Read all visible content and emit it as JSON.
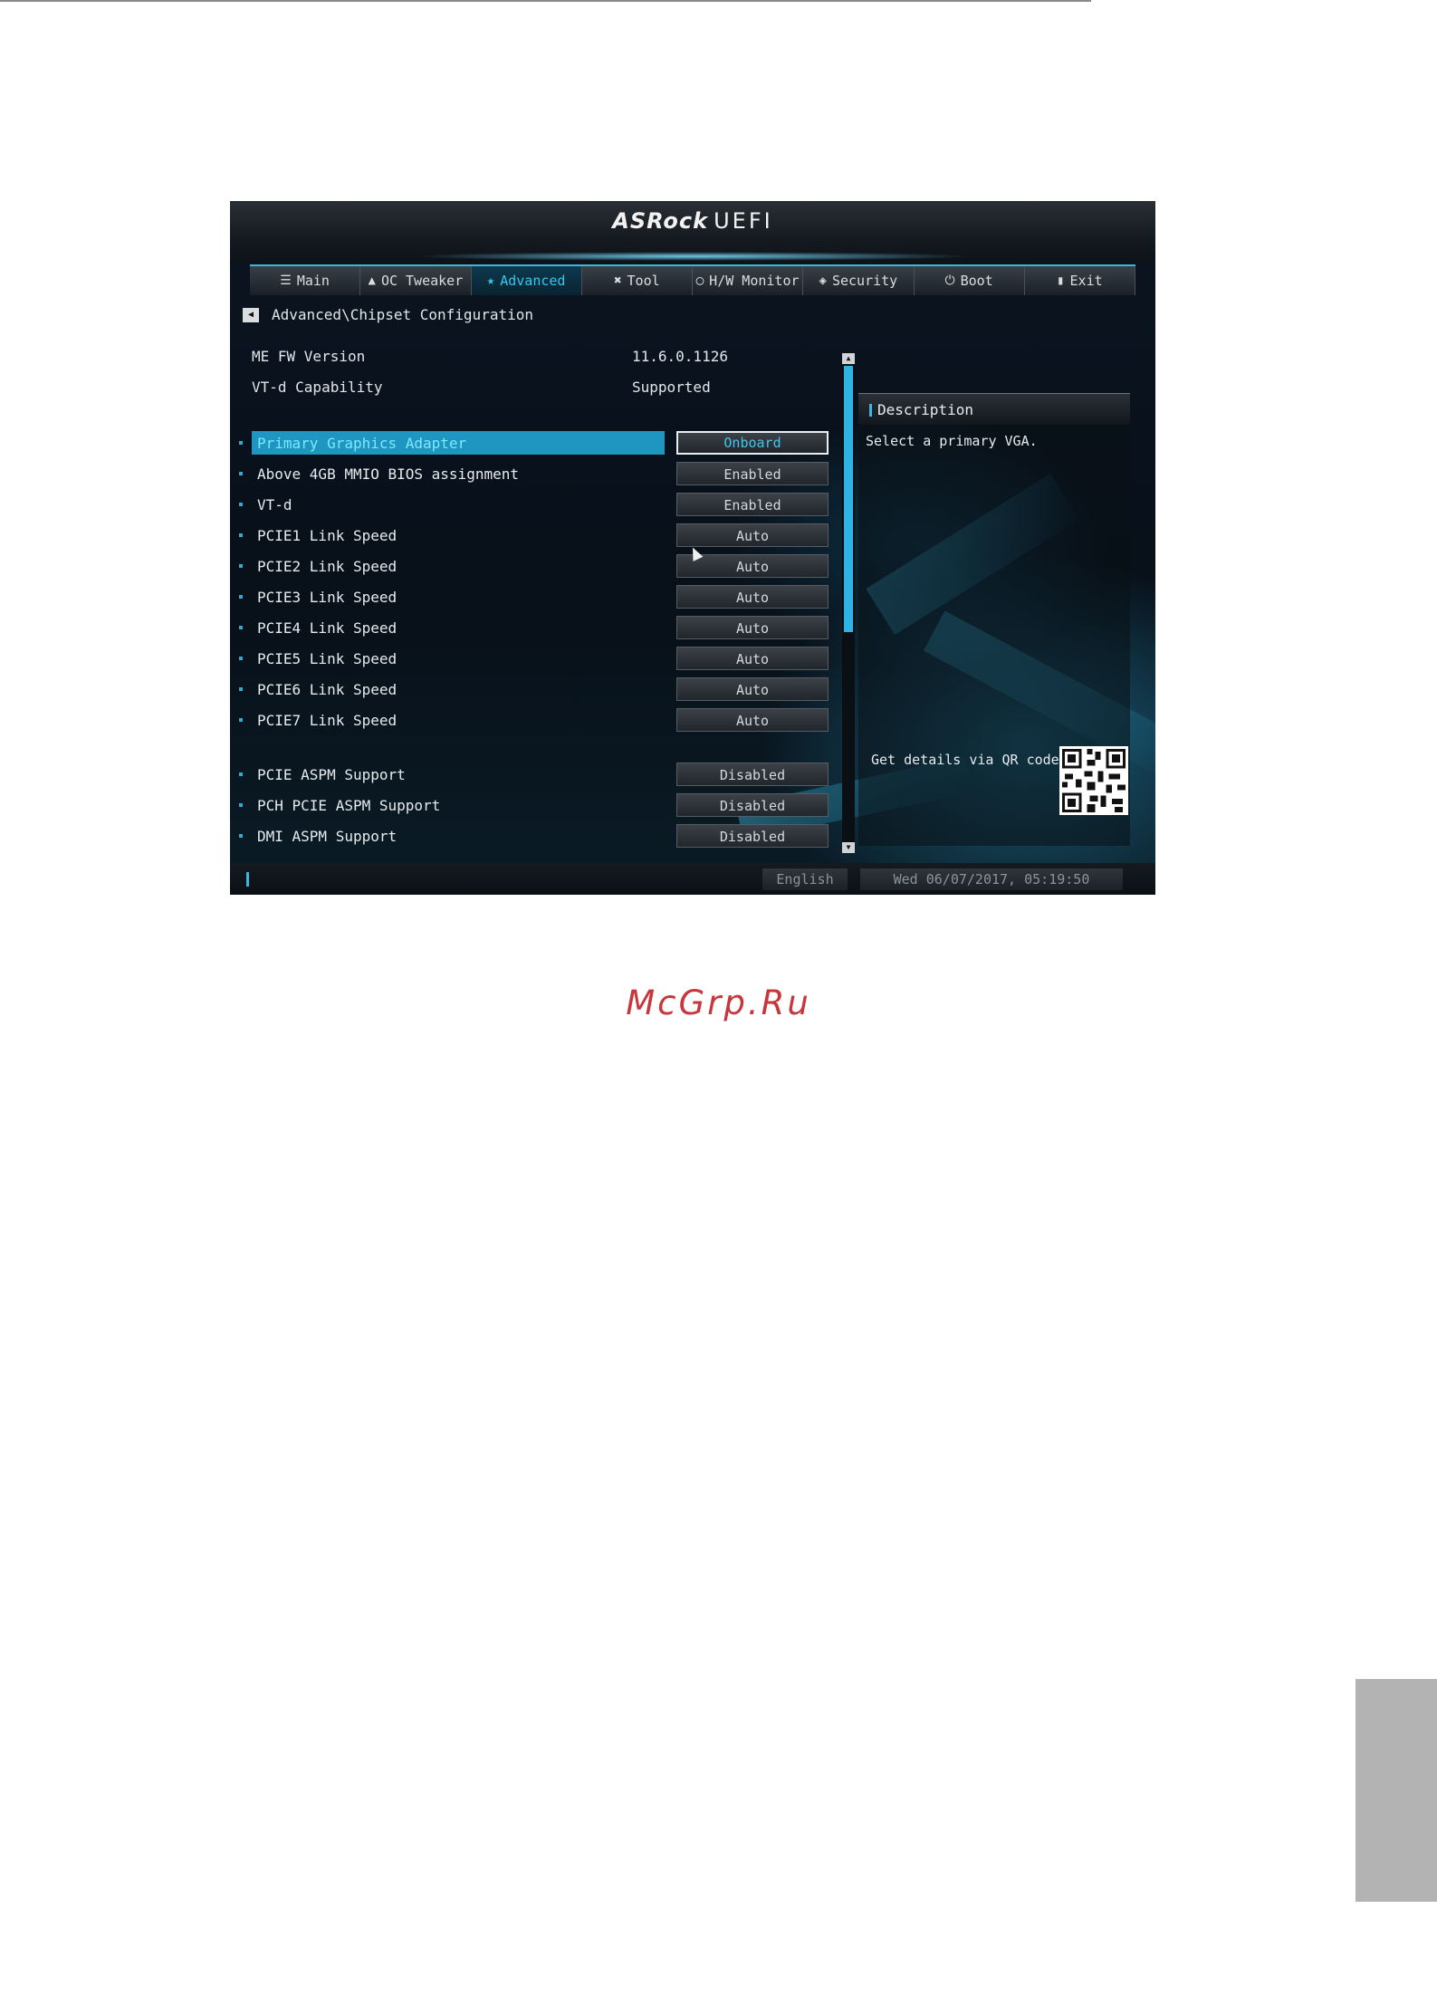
{
  "watermark": "McGrp.Ru",
  "uefi": {
    "brand": "ASRock",
    "brand_suffix": "UEFI",
    "tabs": [
      {
        "icon": "☰",
        "label": "Main"
      },
      {
        "icon": "▲",
        "label": "OC Tweaker"
      },
      {
        "icon": "★",
        "label": "Advanced"
      },
      {
        "icon": "✖",
        "label": "Tool"
      },
      {
        "icon": "◯",
        "label": "H/W Monitor"
      },
      {
        "icon": "◈",
        "label": "Security"
      },
      {
        "icon": "⏻",
        "label": "Boot"
      },
      {
        "icon": "▮",
        "label": "Exit"
      }
    ],
    "active_tab": "Advanced",
    "breadcrumb": "Advanced\\Chipset Configuration",
    "info": [
      {
        "label": "ME FW Version",
        "value": "11.6.0.1126"
      },
      {
        "label": "VT-d Capability",
        "value": "Supported"
      }
    ],
    "settings": [
      {
        "label": "Primary Graphics Adapter",
        "value": "Onboard"
      },
      {
        "label": "Above 4GB MMIO BIOS assignment",
        "value": "Enabled"
      },
      {
        "label": "VT-d",
        "value": "Enabled"
      },
      {
        "label": "PCIE1 Link Speed",
        "value": "Auto"
      },
      {
        "label": "PCIE2 Link Speed",
        "value": "Auto"
      },
      {
        "label": "PCIE3 Link Speed",
        "value": "Auto"
      },
      {
        "label": "PCIE4 Link Speed",
        "value": "Auto"
      },
      {
        "label": "PCIE5 Link Speed",
        "value": "Auto"
      },
      {
        "label": "PCIE6 Link Speed",
        "value": "Auto"
      },
      {
        "label": "PCIE7 Link Speed",
        "value": "Auto"
      },
      {
        "label": "PCIE ASPM Support",
        "value": "Disabled"
      },
      {
        "label": "PCH PCIE ASPM Support",
        "value": "Disabled"
      },
      {
        "label": "DMI ASPM Support",
        "value": "Disabled"
      }
    ],
    "description": {
      "title": "Description",
      "text": "Select a primary VGA.",
      "qr_text": "Get details via QR code"
    },
    "footer": {
      "language": "English",
      "datetime": "Wed 06/07/2017, 05:19:50"
    },
    "colors": {
      "accent": "#2db3e4",
      "selected": "#1f95c2"
    }
  }
}
